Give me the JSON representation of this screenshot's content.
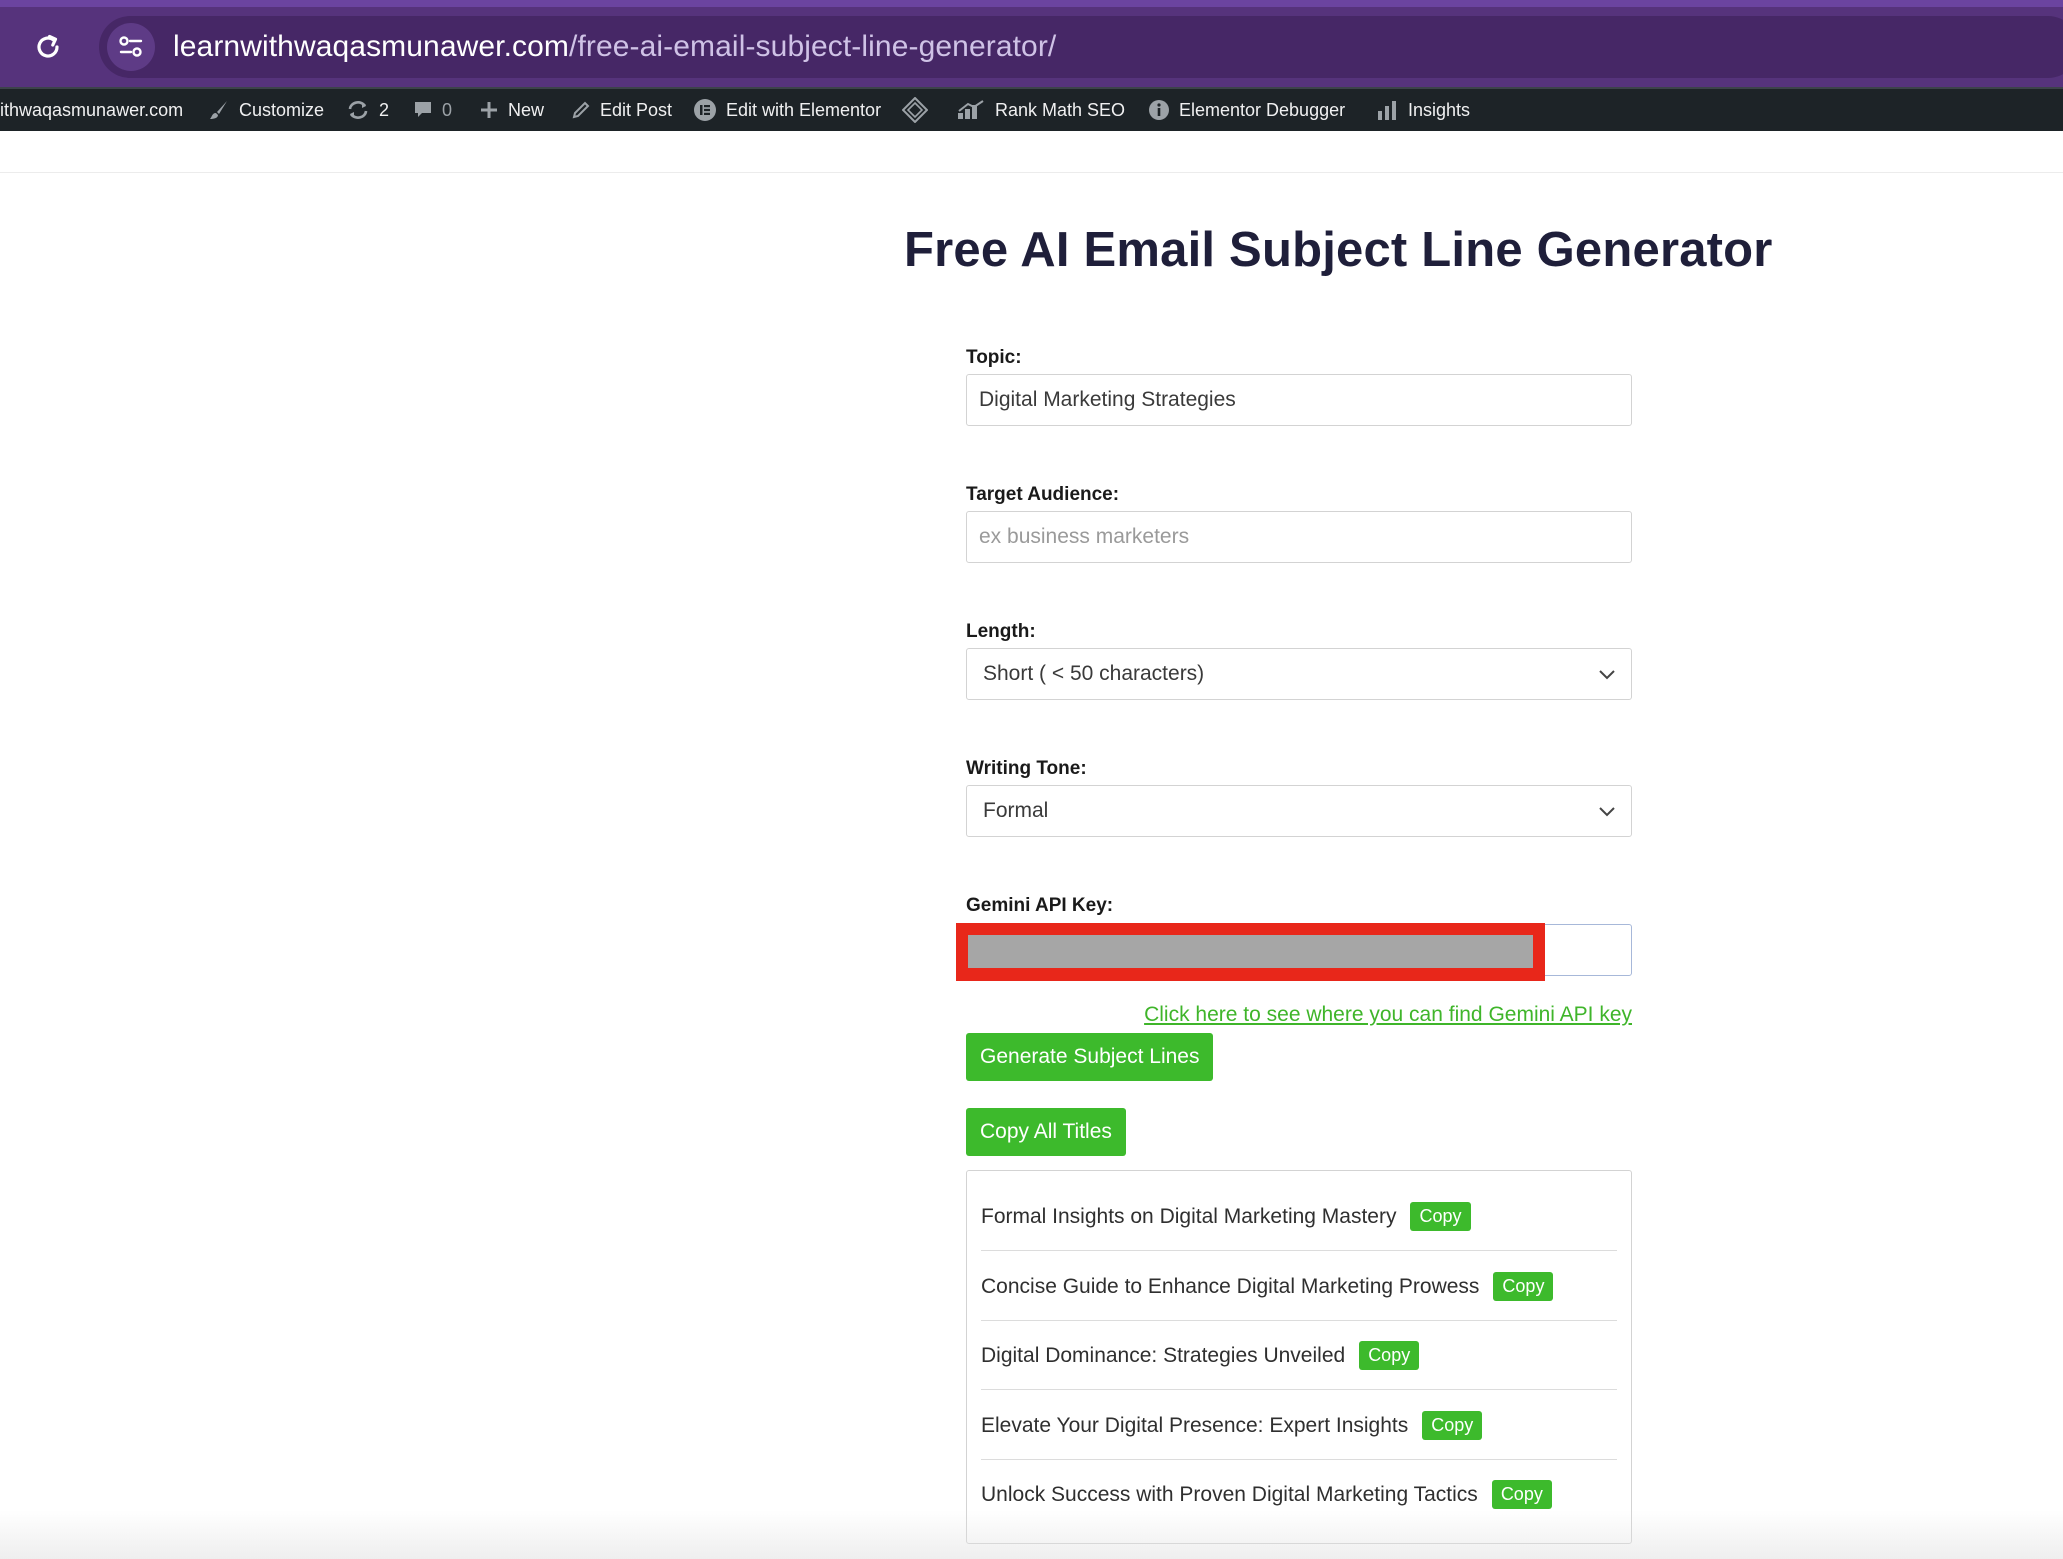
{
  "browser": {
    "url_host": "learnwithwaqasmunawer.com",
    "url_path": "/free-ai-email-subject-line-generator/"
  },
  "admin_bar": {
    "site_name": "ithwaqasmunawer.com",
    "customize": "Customize",
    "updates_count": "2",
    "comments_count": "0",
    "new": "New",
    "edit_post": "Edit Post",
    "edit_elementor": "Edit with Elementor",
    "rank_math": "Rank Math SEO",
    "elementor_debugger": "Elementor Debugger",
    "insights": "Insights"
  },
  "page": {
    "title": "Free AI Email Subject Line Generator"
  },
  "form": {
    "topic_label": "Topic:",
    "topic_value": "Digital Marketing Strategies",
    "audience_label": "Target Audience:",
    "audience_placeholder": "ex business marketers",
    "length_label": "Length:",
    "length_value": "Short ( < 50 characters)",
    "tone_label": "Writing Tone:",
    "tone_value": "Formal",
    "api_label": "Gemini API Key:",
    "help_link": "Click here to see where you can find Gemini API key",
    "generate_button": "Generate Subject Lines",
    "copy_all_button": "Copy All Titles"
  },
  "results": [
    {
      "text": "Formal Insights on Digital Marketing Mastery",
      "copy": "Copy"
    },
    {
      "text": "Concise Guide to Enhance Digital Marketing Prowess",
      "copy": "Copy"
    },
    {
      "text": "Digital Dominance: Strategies Unveiled",
      "copy": "Copy"
    },
    {
      "text": "Elevate Your Digital Presence: Expert Insights",
      "copy": "Copy"
    },
    {
      "text": "Unlock Success with Proven Digital Marketing Tactics",
      "copy": "Copy"
    }
  ],
  "colors": {
    "browser_bar": "#56337c",
    "admin_bar": "#1d2327",
    "accent_green": "#3dba2c",
    "redaction": "#e8271a"
  },
  "icons": [
    "reload-icon",
    "tune-icon",
    "brush-icon",
    "updates-icon",
    "comment-icon",
    "plus-icon",
    "pencil-icon",
    "elementor-icon",
    "diamond-icon",
    "rank-math-icon",
    "info-icon",
    "bar-chart-icon",
    "chevron-down-icon"
  ]
}
